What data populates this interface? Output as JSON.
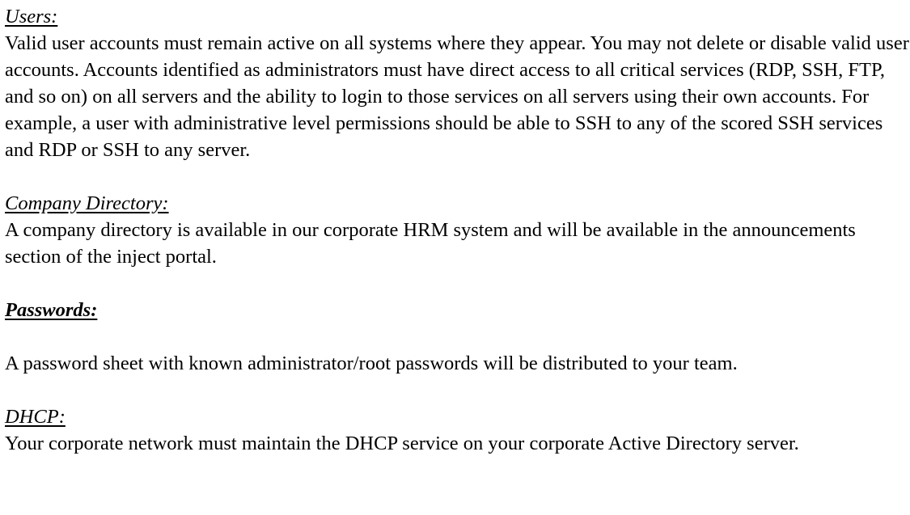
{
  "sections": [
    {
      "heading": "Users:",
      "body": "Valid user accounts must remain active on all systems where they appear.  You may not delete or disable valid user accounts.  Accounts identified as administrators must have direct access to all critical services (RDP, SSH, FTP, and so on) on all servers and the ability to login to those services on all servers using their own accounts. For example, a user with administrative level permissions should be able to SSH to any of the scored SSH services and RDP or SSH to any server."
    },
    {
      "heading": "Company Directory:",
      "body": "A company directory is available in our corporate HRM system and will be available in the announcements section of the inject portal."
    },
    {
      "heading": "Passwords:",
      "body": "A password sheet with known administrator/root passwords will be distributed to your team."
    },
    {
      "heading": "DHCP:",
      "body": "Your corporate network must maintain the DHCP service on your corporate Active Directory server."
    }
  ]
}
